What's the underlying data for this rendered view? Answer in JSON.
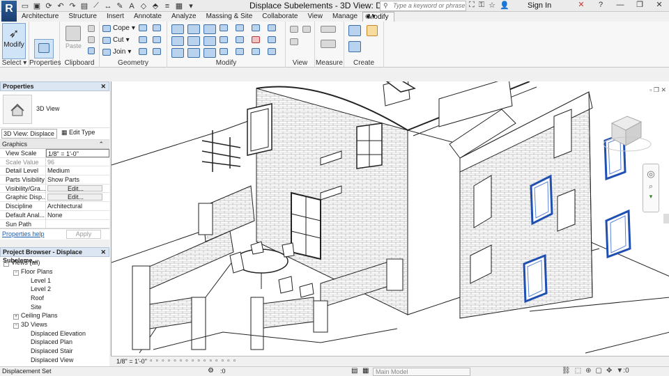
{
  "titlebar": {
    "app_letter": "R",
    "qat_icons": [
      "open-icon",
      "save-icon",
      "sync-icon",
      "undo-icon",
      "redo-icon",
      "print-icon",
      "measure-icon",
      "dimension-icon",
      "tag-icon",
      "text-icon",
      "3d-view-icon",
      "section-icon",
      "thin-lines-icon",
      "close-hidden-icon",
      "switch-windows-icon"
    ],
    "qat_glyphs": [
      "▭",
      "▣",
      "⟳",
      "↶",
      "↷",
      "▤",
      "⟋",
      "↔",
      "✎",
      "A",
      "◇",
      "⬘",
      "≡",
      "▦",
      "▾"
    ],
    "title": "Displace Subelements - 3D View: Di...",
    "search_placeholder": "Type a keyword or phrase",
    "sign_in": "Sign In"
  },
  "tabs": [
    {
      "label": "Architecture",
      "active": false
    },
    {
      "label": "Structure",
      "active": false
    },
    {
      "label": "Insert",
      "active": false
    },
    {
      "label": "Annotate",
      "active": false
    },
    {
      "label": "Analyze",
      "active": false
    },
    {
      "label": "Massing & Site",
      "active": false
    },
    {
      "label": "Collaborate",
      "active": false
    },
    {
      "label": "View",
      "active": false
    },
    {
      "label": "Manage",
      "active": false
    },
    {
      "label": "Modify",
      "active": true
    }
  ],
  "ribbon": {
    "modify_label": "Modify",
    "select_label": "Select",
    "properties_label": "Properties",
    "clipboard_label": "Clipboard",
    "paste_label": "Paste",
    "geometry_label": "Geometry",
    "cope_label": "Cope",
    "cut_label": "Cut",
    "join_label": "Join",
    "modify_panel_label": "Modify",
    "view_label": "View",
    "measure_label": "Measure",
    "create_label": "Create"
  },
  "properties": {
    "header": "Properties",
    "type_name": "3D View",
    "selector": "3D View: Displace",
    "edit_type": "Edit Type",
    "group": "Graphics",
    "rows": [
      {
        "key": "View Scale",
        "value": "1/8\" = 1'-0\"",
        "button": false
      },
      {
        "key": "Scale Value",
        "value": "96",
        "button": false
      },
      {
        "key": "Detail Level",
        "value": "Medium",
        "button": false
      },
      {
        "key": "Parts Visibility",
        "value": "Show Parts",
        "button": false
      },
      {
        "key": "Visibility/Gra...",
        "value": "Edit...",
        "button": true
      },
      {
        "key": "Graphic Disp...",
        "value": "Edit...",
        "button": true
      },
      {
        "key": "Discipline",
        "value": "Architectural",
        "button": false
      },
      {
        "key": "Default Anal...",
        "value": "None",
        "button": false
      },
      {
        "key": "Sun Path",
        "value": "",
        "button": false
      }
    ],
    "help_link": "Properties help",
    "apply": "Apply"
  },
  "browser": {
    "header": "Project Browser - Displace Subeleme...",
    "nodes": [
      {
        "label": "Views (all)",
        "level": 0,
        "toggle": "−"
      },
      {
        "label": "Floor Plans",
        "level": 1,
        "toggle": "−"
      },
      {
        "label": "Level 1",
        "level": 2,
        "toggle": ""
      },
      {
        "label": "Level 2",
        "level": 2,
        "toggle": ""
      },
      {
        "label": "Roof",
        "level": 2,
        "toggle": ""
      },
      {
        "label": "Site",
        "level": 2,
        "toggle": ""
      },
      {
        "label": "Ceiling Plans",
        "level": 1,
        "toggle": "+"
      },
      {
        "label": "3D Views",
        "level": 1,
        "toggle": "−"
      },
      {
        "label": "Displaced Elevation",
        "level": 2,
        "toggle": ""
      },
      {
        "label": "Displaced Plan",
        "level": 2,
        "toggle": ""
      },
      {
        "label": "Displaced Stair",
        "level": 2,
        "toggle": ""
      },
      {
        "label": "Displaced View",
        "level": 2,
        "toggle": ""
      }
    ]
  },
  "view_bar": {
    "scale": "1/8\" = 1'-0\""
  },
  "status": {
    "text": "Displacement Set",
    "model": "Main Model",
    "zero": ":0"
  },
  "colors": {
    "accent": "#1f4fb0",
    "blue_window": "#2a56c6"
  }
}
